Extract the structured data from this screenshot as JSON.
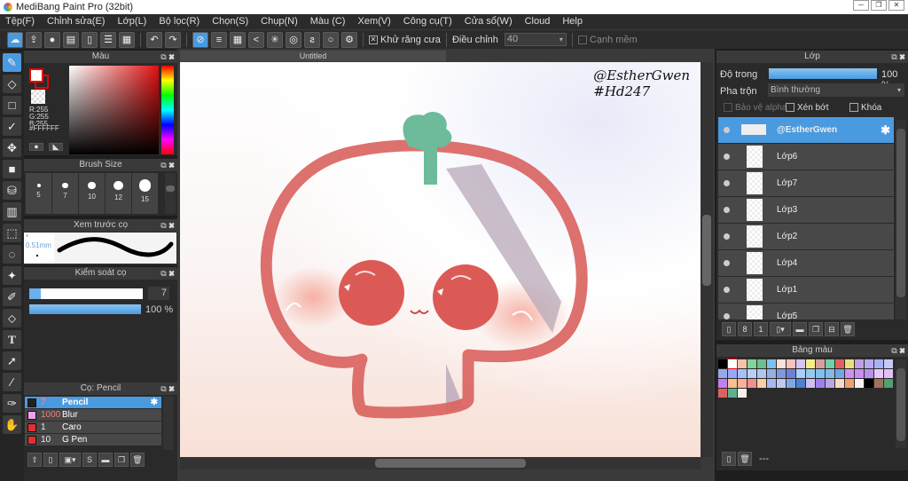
{
  "title": "MediBang Paint Pro (32bit)",
  "menu": [
    "Tệp(F)",
    "Chỉnh sửa(E)",
    "Lớp(L)",
    "Bộ lọc(R)",
    "Chọn(S)",
    "Chụp(N)",
    "Màu (C)",
    "Xem(V)",
    "Công cụ(T)",
    "Cửa sổ(W)",
    "Cloud",
    "Help"
  ],
  "toolbar": {
    "antialias": "Khử răng cưa",
    "adjust": "Điều chỉnh",
    "adjust_value": "40",
    "soft_edge": "Cạnh mềm"
  },
  "color_panel": {
    "title": "Màu",
    "r": "R:255",
    "g": "G:255",
    "b": "B:255",
    "hex": "#FFFFFF",
    "primary": "#ffffff",
    "secondary": "#f8b8a8"
  },
  "brush_size": {
    "title": "Brush Size",
    "sizes": [
      "5",
      "7",
      "10",
      "12",
      "15"
    ]
  },
  "brush_preview": {
    "title": "Xem trước cọ",
    "size": "0.51mm"
  },
  "brush_control": {
    "title": "Kiểm soát cọ",
    "size": "7",
    "size_fraction": 0.1,
    "opacity": "100 %"
  },
  "brush_list": {
    "title": "Cọ: Pencil",
    "items": [
      {
        "size": "7",
        "name": "Pencil",
        "color": "#222222"
      },
      {
        "size": "1000",
        "name": "Blur",
        "color": "#f0a0f0"
      },
      {
        "size": "1",
        "name": "Caro",
        "color": "#e03030"
      },
      {
        "size": "10",
        "name": "G Pen",
        "color": "#e03030"
      }
    ]
  },
  "document": {
    "tab": "Untitled",
    "signature1": "@EstherGwen",
    "signature2": "#Hd247"
  },
  "layers": {
    "title": "Lớp",
    "opacity_label": "Độ trong",
    "opacity": "100 %",
    "blend_label": "Pha trộn",
    "blend": "Bình thường",
    "protect_alpha": "Bảo vệ alpha",
    "clip": "Xén bớt",
    "lock": "Khóa",
    "items": [
      "@EstherGwen",
      "Lớp6",
      "Lớp7",
      "Lớp3",
      "Lớp2",
      "Lớp4",
      "Lớp1",
      "Lớp5"
    ]
  },
  "palette": {
    "title": "Bảng màu",
    "footer": "---",
    "colors": [
      "#000000",
      "#ffffff",
      "#f6c2a8",
      "#7fd79c",
      "#6fbf8f",
      "#7fc0ef",
      "#f9e0d8",
      "#f5c4bc",
      "#d6c4f2",
      "#f4ee88",
      "#d6a0a0",
      "#6fcfa6",
      "#e06060",
      "#e8e080",
      "#c0a0e0",
      "#b8a8f0",
      "#a8b0f8",
      "#c8c8f8",
      "#98a8e8",
      "#98a8f8",
      "#a8c0f8",
      "#b8d0f8",
      "#b0c8f0",
      "#98b0e0",
      "#8098e0",
      "#7080d8",
      "#a8d0f8",
      "#98c8f0",
      "#80c0f0",
      "#88b8e8",
      "#70a8e0",
      "#d090f0",
      "#c890f0",
      "#b890f0",
      "#e8c8f8",
      "#e0c0f8",
      "#c080f0",
      "#f8c090",
      "#f8b0a0",
      "#f09090",
      "#f8d0a8",
      "#a8b8f0",
      "#c0c8f0",
      "#80a8e8",
      "#5080d0",
      "#d0c0f0",
      "#a080f0",
      "#b8a8e0",
      "#f8d8c8",
      "#f0a070",
      "#f8f0f0",
      "#000000",
      "#a07060",
      "#50a070",
      "#e06060",
      "#60b090",
      "#f8f0e8"
    ]
  }
}
